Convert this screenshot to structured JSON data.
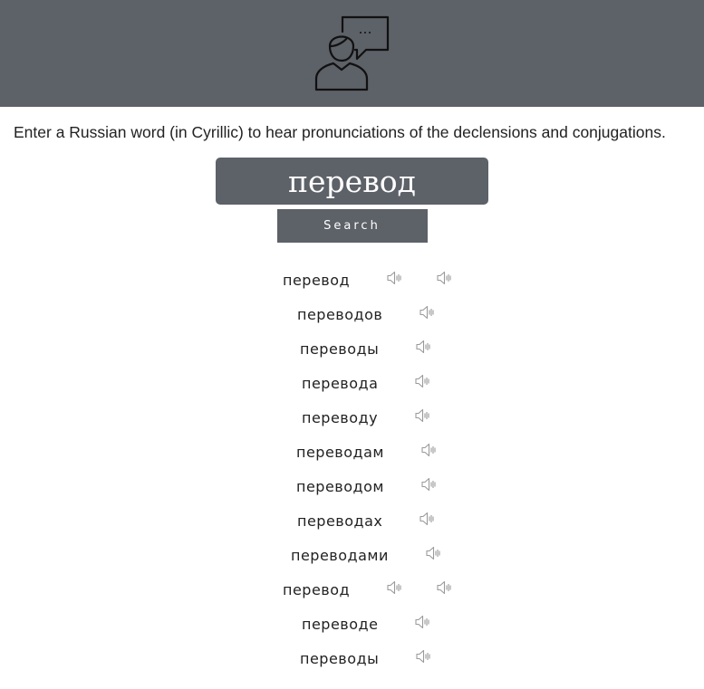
{
  "header": {
    "logo_icon": "person-speech-bubble-icon",
    "background": "#5d6168"
  },
  "intro_text": "Enter a Russian word (in Cyrillic) to hear pronunciations of the declensions and conjugations.",
  "search": {
    "value": "перевод",
    "button_label": "Search"
  },
  "speaker_icon": "speaker-icon",
  "results": [
    {
      "word": "перевод",
      "audio_count": 2
    },
    {
      "word": "переводов",
      "audio_count": 1
    },
    {
      "word": "переводы",
      "audio_count": 1
    },
    {
      "word": "перевода",
      "audio_count": 1
    },
    {
      "word": "переводу",
      "audio_count": 1
    },
    {
      "word": "переводам",
      "audio_count": 1
    },
    {
      "word": "переводом",
      "audio_count": 1
    },
    {
      "word": "переводах",
      "audio_count": 1
    },
    {
      "word": "переводами",
      "audio_count": 1
    },
    {
      "word": "перевод",
      "audio_count": 2
    },
    {
      "word": "переводе",
      "audio_count": 1
    },
    {
      "word": "переводы",
      "audio_count": 1
    }
  ]
}
